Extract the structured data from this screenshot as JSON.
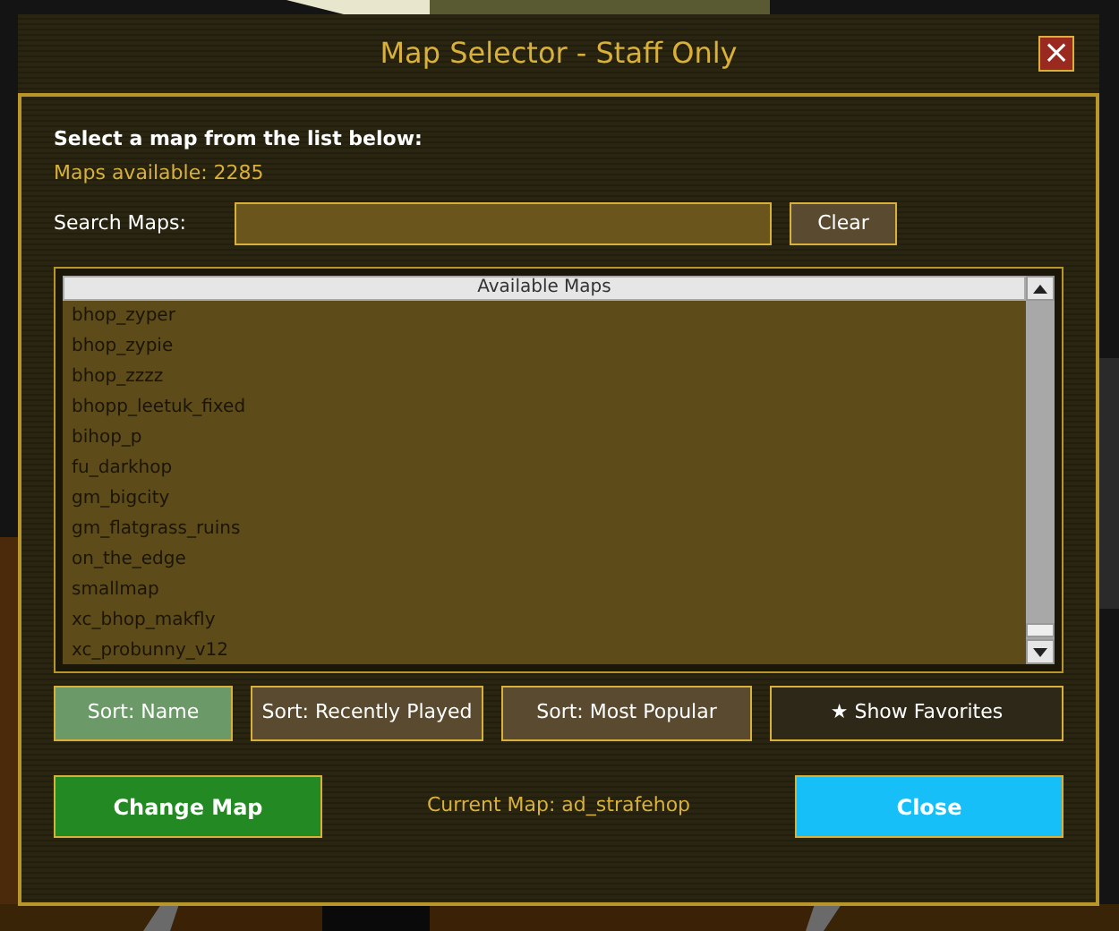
{
  "window": {
    "title": "Map Selector - Staff Only",
    "close_glyph": "×"
  },
  "instruction": "Select a map from the list below:",
  "maps_available": "Maps available: 2285",
  "search": {
    "label": "Search Maps:",
    "clear": "Clear"
  },
  "map_list": {
    "header": "Available Maps",
    "items": [
      {
        "name": "bhop_zyper",
        "selected": false
      },
      {
        "name": "bhop_zypie",
        "selected": false
      },
      {
        "name": "bhop_zzzz",
        "selected": false
      },
      {
        "name": "bhopp_leetuk_fixed",
        "selected": false
      },
      {
        "name": "bihop_p",
        "selected": false
      },
      {
        "name": "fu_darkhop",
        "selected": false
      },
      {
        "name": "gm_bigcity",
        "selected": false
      },
      {
        "name": "gm_flatgrass_ruins",
        "selected": false
      },
      {
        "name": "on_the_edge",
        "selected": false
      },
      {
        "name": "smallmap",
        "selected": false
      },
      {
        "name": "xc_bhop_makfly",
        "selected": false
      },
      {
        "name": "xc_probunny_v12",
        "selected": false
      }
    ]
  },
  "sort_buttons": [
    {
      "label": "Sort: Name",
      "selected": true
    },
    {
      "label": "Sort: Recently Played",
      "selected": false
    },
    {
      "label": "Sort: Most Popular",
      "selected": false
    }
  ],
  "favorites_button": {
    "label": "★ Show Favorites",
    "on": false
  },
  "change_map": "Change Map",
  "current_map": "Current Map: ad_strafehop",
  "close": "Close"
}
